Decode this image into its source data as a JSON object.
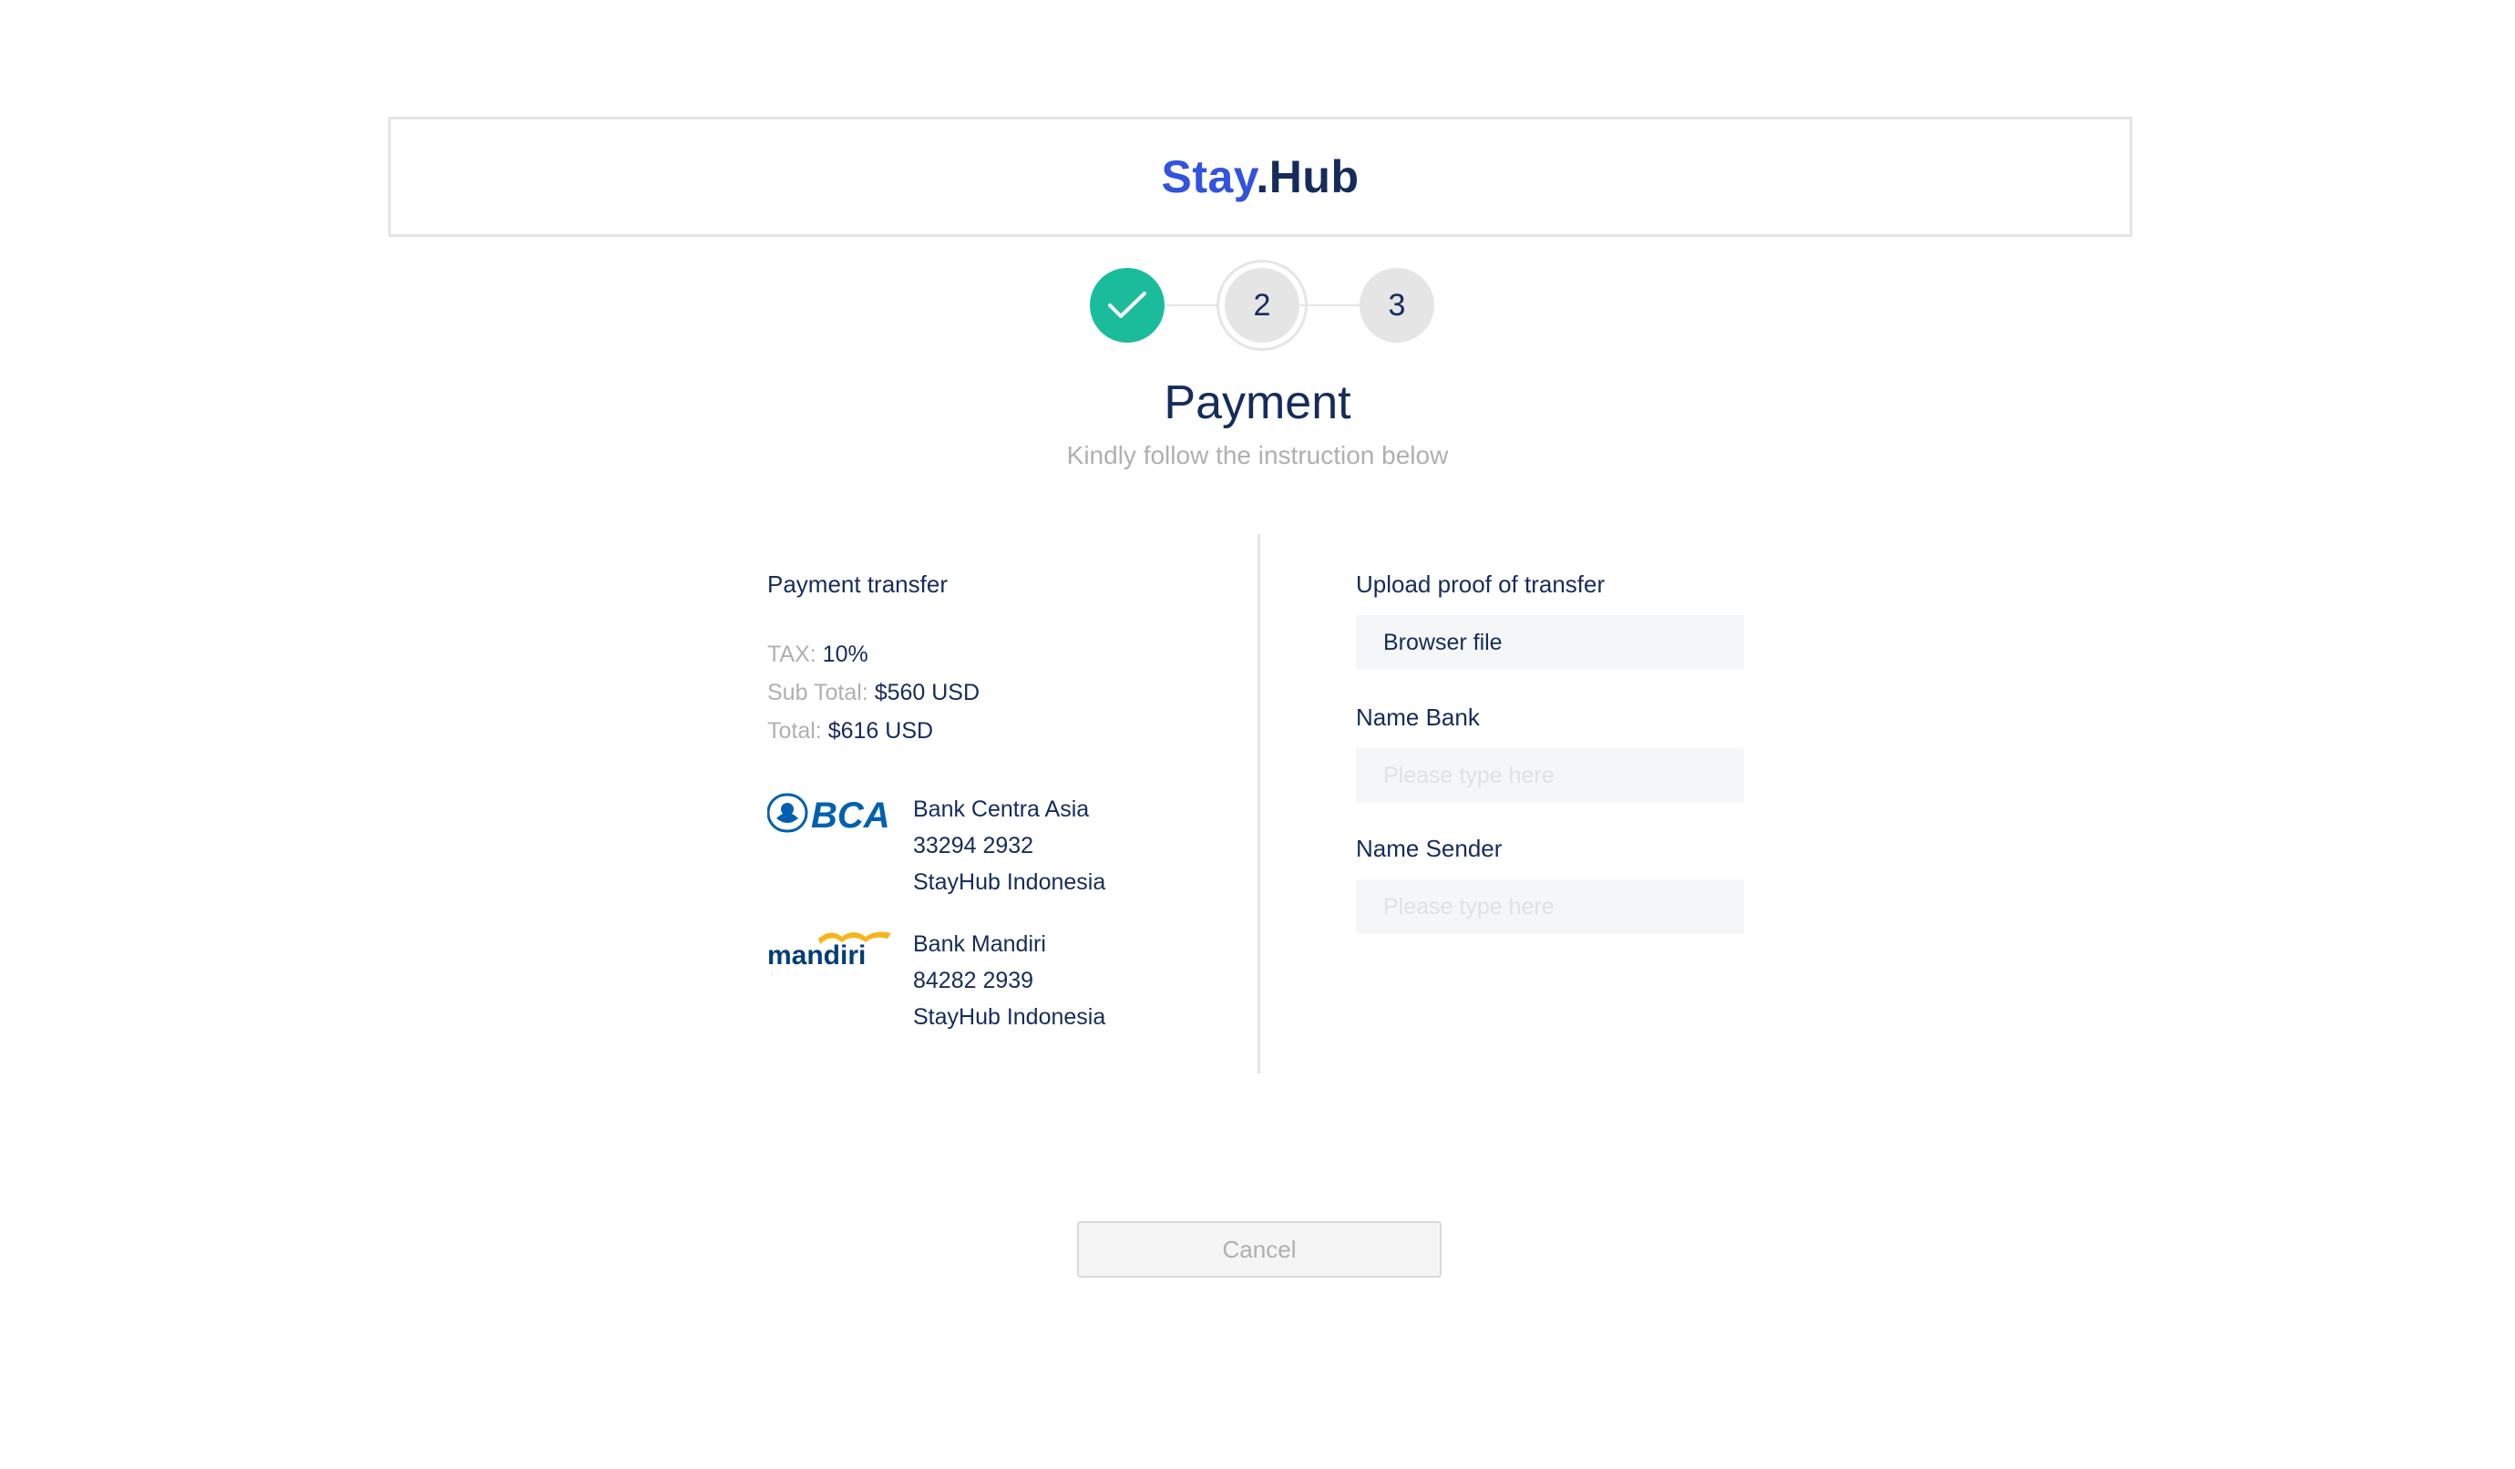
{
  "brand": {
    "part1": "Stay",
    "part2": ".Hub"
  },
  "stepper": {
    "steps": [
      {
        "label": "",
        "state": "done"
      },
      {
        "label": "2",
        "state": "current"
      },
      {
        "label": "3",
        "state": "pending"
      }
    ]
  },
  "page": {
    "title": "Payment",
    "subtitle": "Kindly follow the instruction below"
  },
  "payment": {
    "heading": "Payment transfer",
    "tax_label": "TAX: ",
    "tax_value": "10%",
    "subtotal_label": "Sub Total: ",
    "subtotal_value": "$560 USD",
    "total_label": "Total: ",
    "total_value": "$616 USD",
    "banks": [
      {
        "logo": "BCA",
        "name": "Bank Centra Asia",
        "account": "33294 2932",
        "holder": "StayHub Indonesia"
      },
      {
        "logo": "mandiri",
        "name": "Bank Mandiri",
        "account": "84282 2939",
        "holder": "StayHub Indonesia"
      }
    ]
  },
  "form": {
    "upload_label": "Upload proof of transfer",
    "upload_button": "Browser file",
    "bank_label": "Name Bank",
    "bank_placeholder": "Please type here",
    "sender_label": "Name Sender",
    "sender_placeholder": "Please type here"
  },
  "actions": {
    "cancel": "Cancel"
  },
  "colors": {
    "brand_blue": "#3252DF",
    "navy": "#152C5B",
    "success": "#1ABC9C",
    "muted": "#B0B0B0"
  }
}
